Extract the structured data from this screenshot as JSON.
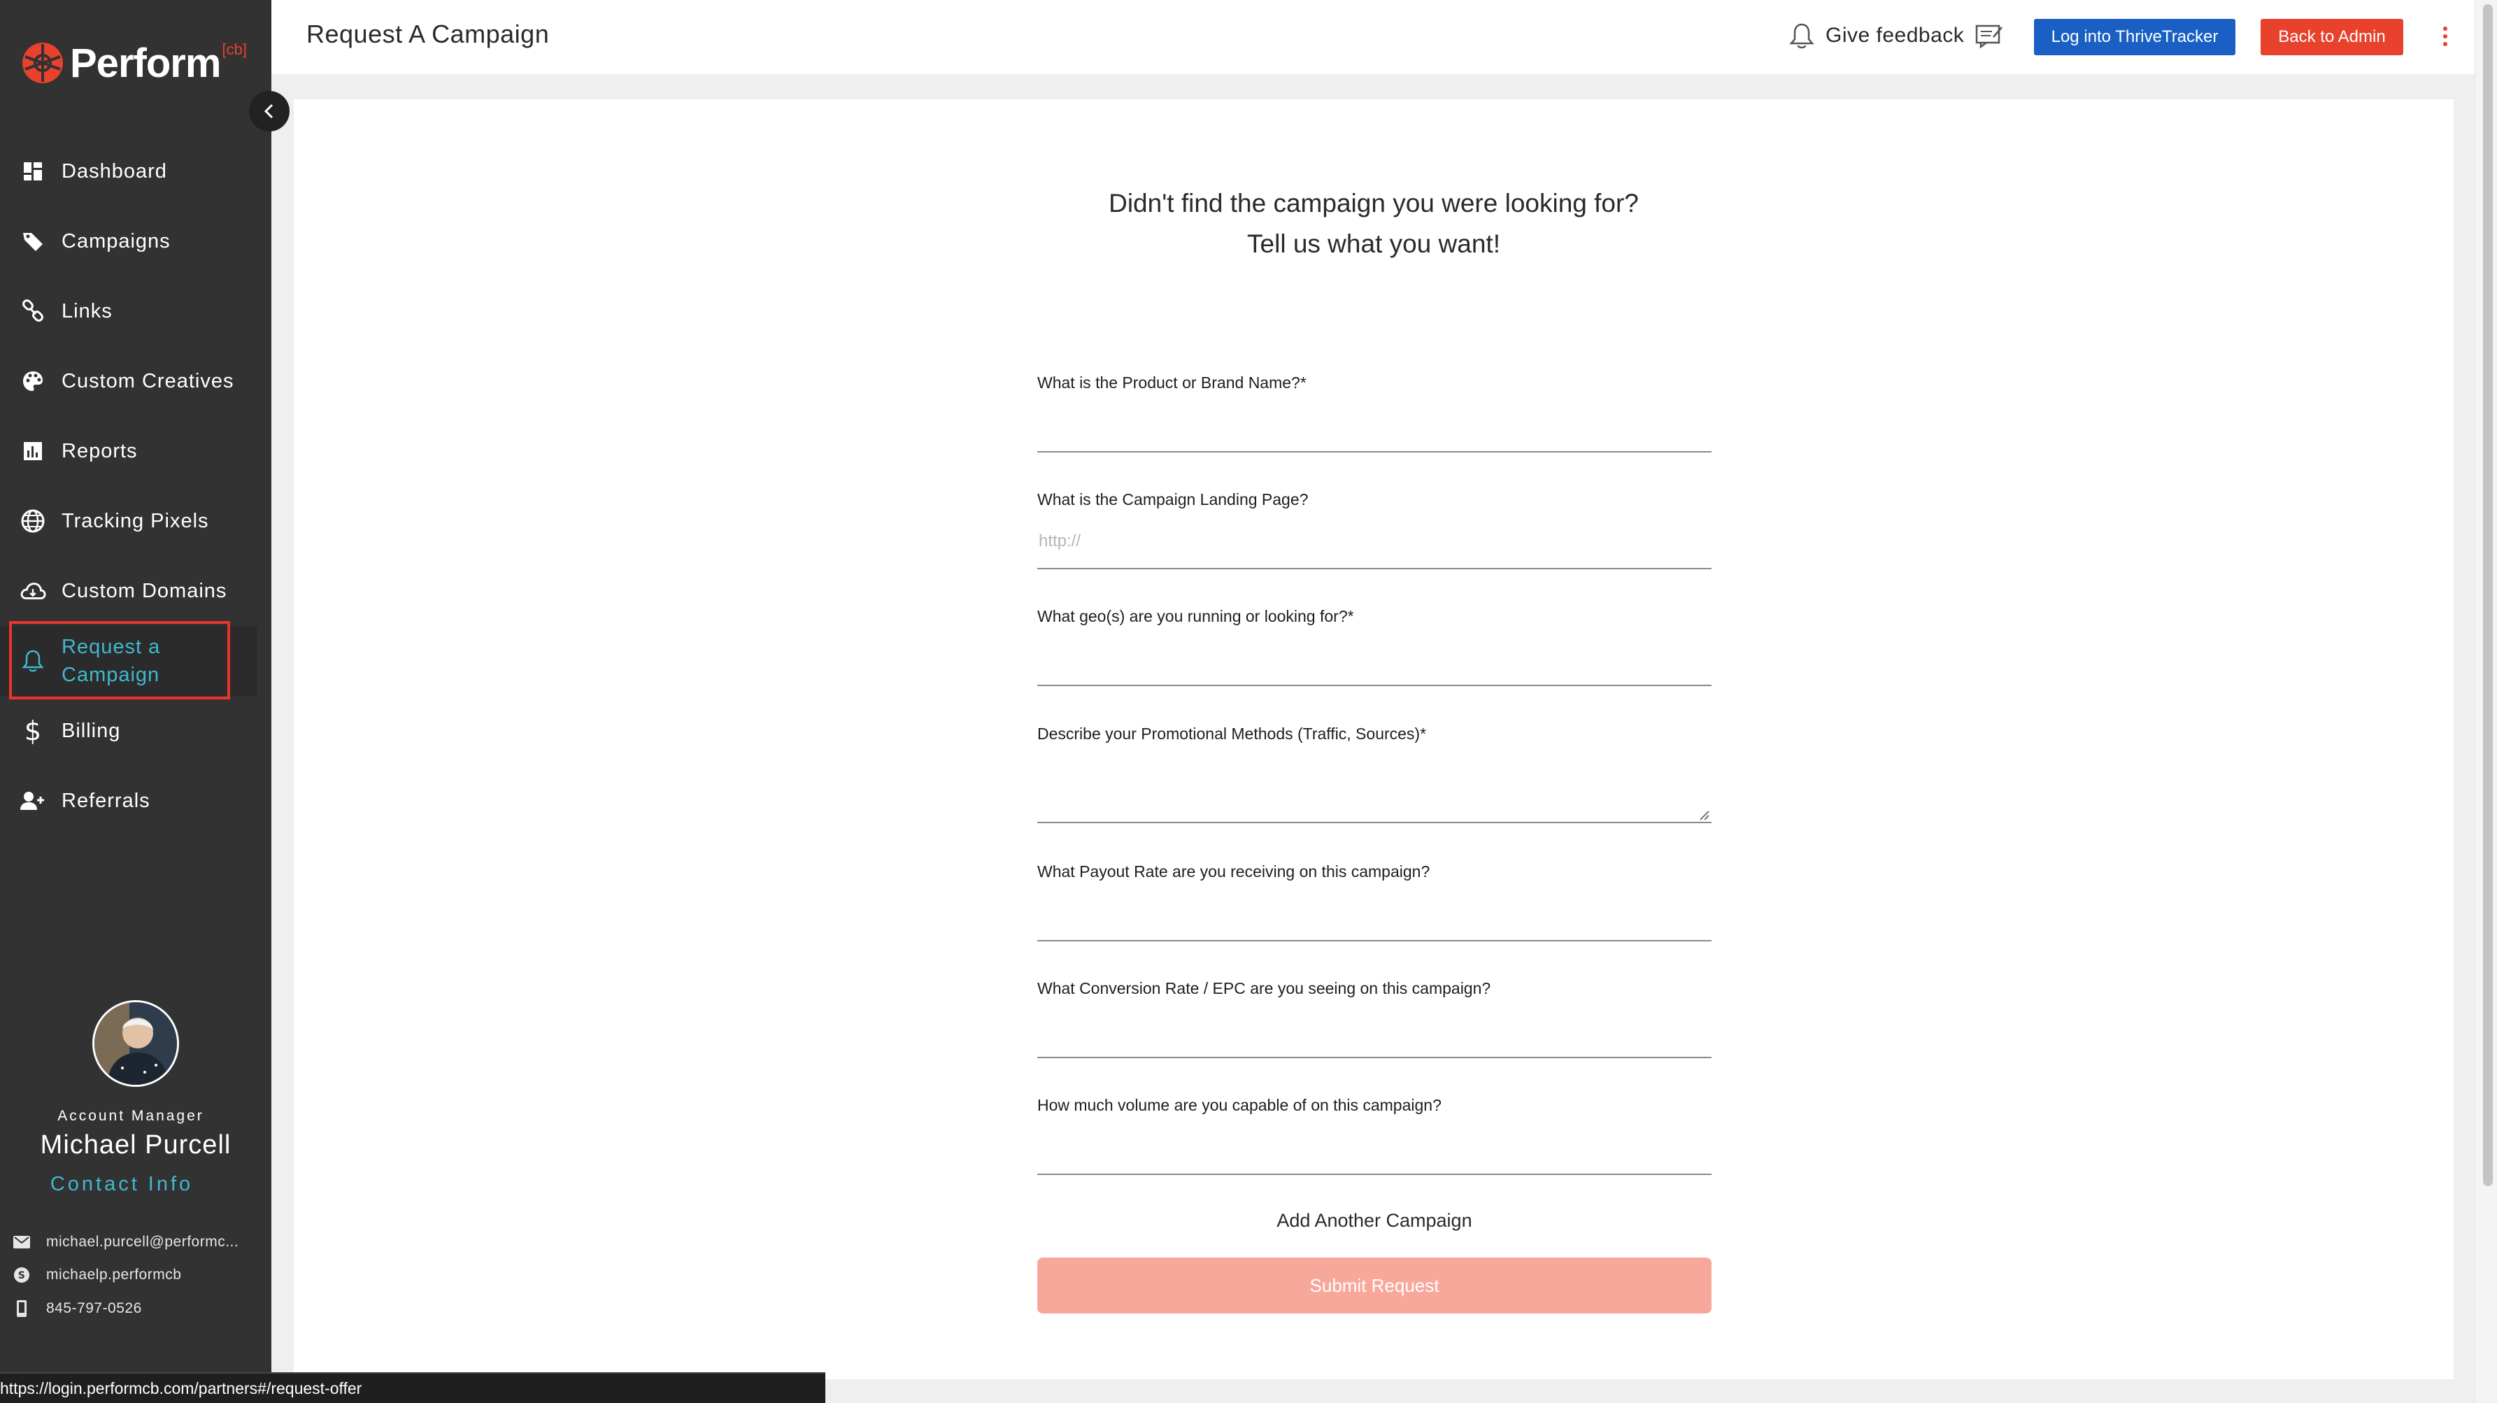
{
  "brand": {
    "name": "Perform",
    "superscript": "[cb]",
    "accent_color": "#e8412c"
  },
  "sidebar": {
    "collapse_icon": "chevron-left-icon",
    "items": [
      {
        "label": "Dashboard",
        "icon": "dashboard-icon"
      },
      {
        "label": "Campaigns",
        "icon": "tag-icon"
      },
      {
        "label": "Links",
        "icon": "link-icon"
      },
      {
        "label": "Custom Creatives",
        "icon": "palette-icon"
      },
      {
        "label": "Reports",
        "icon": "bar-chart-icon"
      },
      {
        "label": "Tracking Pixels",
        "icon": "globe-icon"
      },
      {
        "label": "Custom Domains",
        "icon": "cloud-icon"
      },
      {
        "label": "Request a Campaign",
        "icon": "bell-icon",
        "active": true
      },
      {
        "label": "Billing",
        "icon": "dollar-icon"
      },
      {
        "label": "Referrals",
        "icon": "add-person-icon"
      }
    ],
    "active_color": "#3fb8cf"
  },
  "account_manager": {
    "role": "Account Manager",
    "name": "Michael Purcell",
    "contact_heading": "Contact Info",
    "email": "michael.purcell@performc...",
    "skype": "michaelp.performcb",
    "phone": "845-797-0526"
  },
  "status_bar": {
    "url": "https://login.performcb.com/partners#/request-offer"
  },
  "header": {
    "title": "Request A Campaign",
    "feedback_label": "Give feedback",
    "thrive_button": "Log into ThriveTracker",
    "admin_button": "Back to Admin",
    "thrive_color": "#1a5fc4",
    "admin_color": "#e8412c"
  },
  "form": {
    "intro_line1": "Didn't find the campaign you were looking for?",
    "intro_line2": "Tell us what you want!",
    "fields": [
      {
        "label": "What is the Product or Brand Name?*",
        "placeholder": "",
        "value": ""
      },
      {
        "label": "What is the Campaign Landing Page?",
        "placeholder": "http://",
        "value": ""
      },
      {
        "label": "What geo(s) are you running or looking for?*",
        "placeholder": "",
        "value": ""
      },
      {
        "label": "Describe your Promotional Methods (Traffic, Sources)*",
        "placeholder": "",
        "value": ""
      },
      {
        "label": "What Payout Rate are you receiving on this campaign?",
        "placeholder": "",
        "value": ""
      },
      {
        "label": "What Conversion Rate / EPC are you seeing on this campaign?",
        "placeholder": "",
        "value": ""
      },
      {
        "label": "How much volume are you capable of on this campaign?",
        "placeholder": "",
        "value": ""
      }
    ],
    "add_another": "Add Another Campaign",
    "submit": "Submit Request",
    "submit_color": "#f8a89a"
  }
}
